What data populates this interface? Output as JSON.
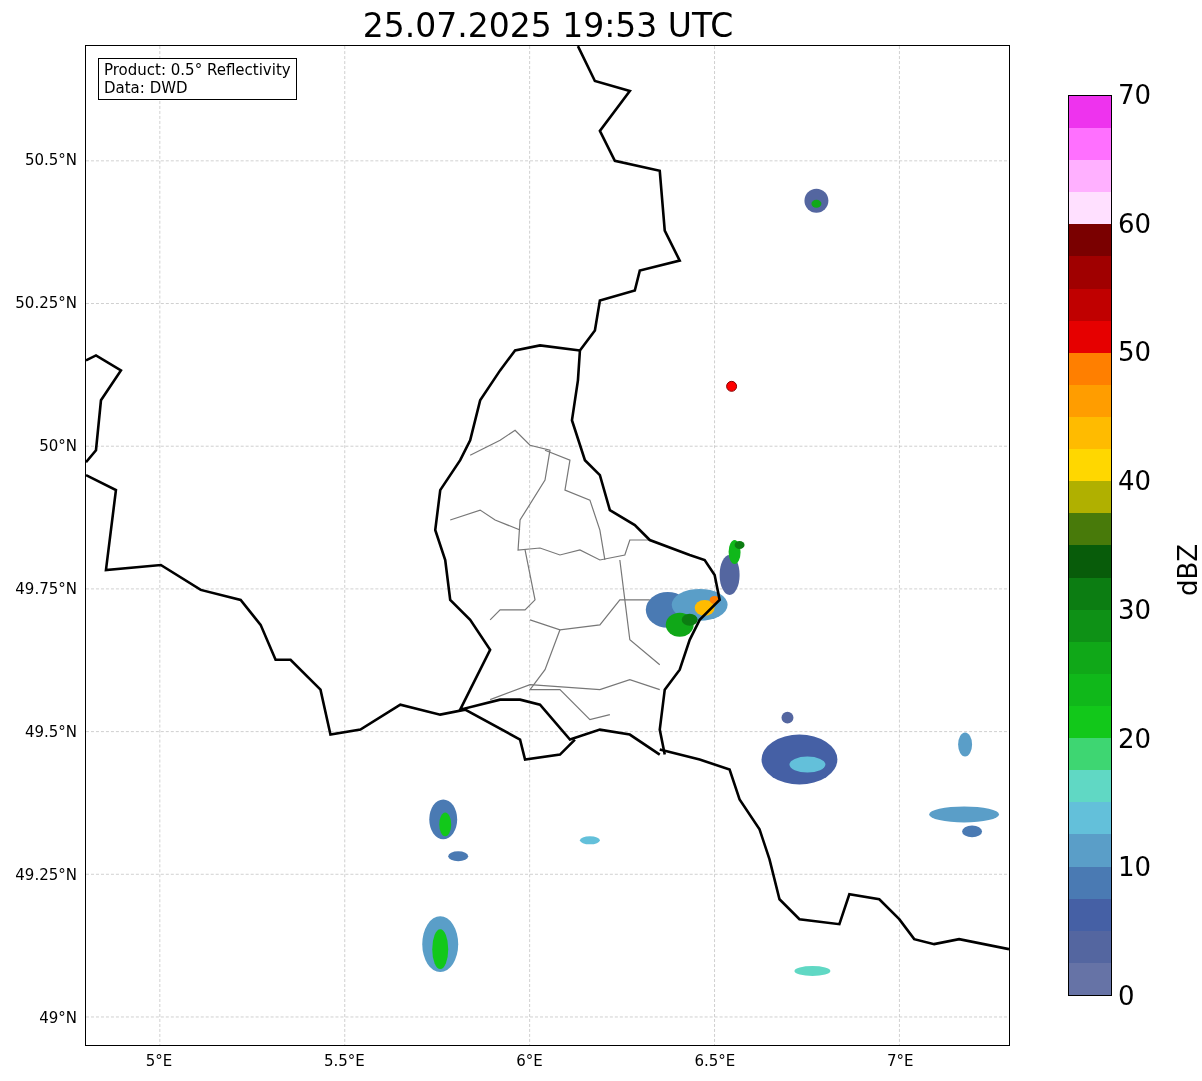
{
  "title": "25.07.2025 19:53 UTC",
  "info_box": [
    "Product: 0.5° Reflectivity",
    "Data: DWD"
  ],
  "lat_ticks": [
    "50.5°N",
    "50.25°N",
    "50°N",
    "49.75°N",
    "49.5°N",
    "49.25°N",
    "49°N"
  ],
  "lon_ticks": [
    "5°E",
    "5.5°E",
    "6°E",
    "6.5°E",
    "7°E"
  ],
  "colorbar": {
    "label": "dBZ",
    "ticks": [
      "70",
      "60",
      "50",
      "40",
      "30",
      "20",
      "10",
      "0"
    ],
    "bins": [
      {
        "color": "#6673a6"
      },
      {
        "color": "#5466a0"
      },
      {
        "color": "#4560a5"
      },
      {
        "color": "#4a7ab3"
      },
      {
        "color": "#5a9ec8"
      },
      {
        "color": "#63c0da"
      },
      {
        "color": "#60d8c4"
      },
      {
        "color": "#3ed672"
      },
      {
        "color": "#12c81a"
      },
      {
        "color": "#10b81a"
      },
      {
        "color": "#10a818"
      },
      {
        "color": "#0e9116"
      },
      {
        "color": "#0c7d12"
      },
      {
        "color": "#085c0a"
      },
      {
        "color": "#487a0a"
      },
      {
        "color": "#b0b000"
      },
      {
        "color": "#ffd700"
      },
      {
        "color": "#ffbb00"
      },
      {
        "color": "#ff9d00"
      },
      {
        "color": "#ff7f00"
      },
      {
        "color": "#e60000"
      },
      {
        "color": "#c00000"
      },
      {
        "color": "#a00000"
      },
      {
        "color": "#7a0000"
      },
      {
        "color": "#ffe0ff"
      },
      {
        "color": "#ffb0ff"
      },
      {
        "color": "#ff70ff"
      },
      {
        "color": "#ee33ee"
      }
    ]
  }
}
